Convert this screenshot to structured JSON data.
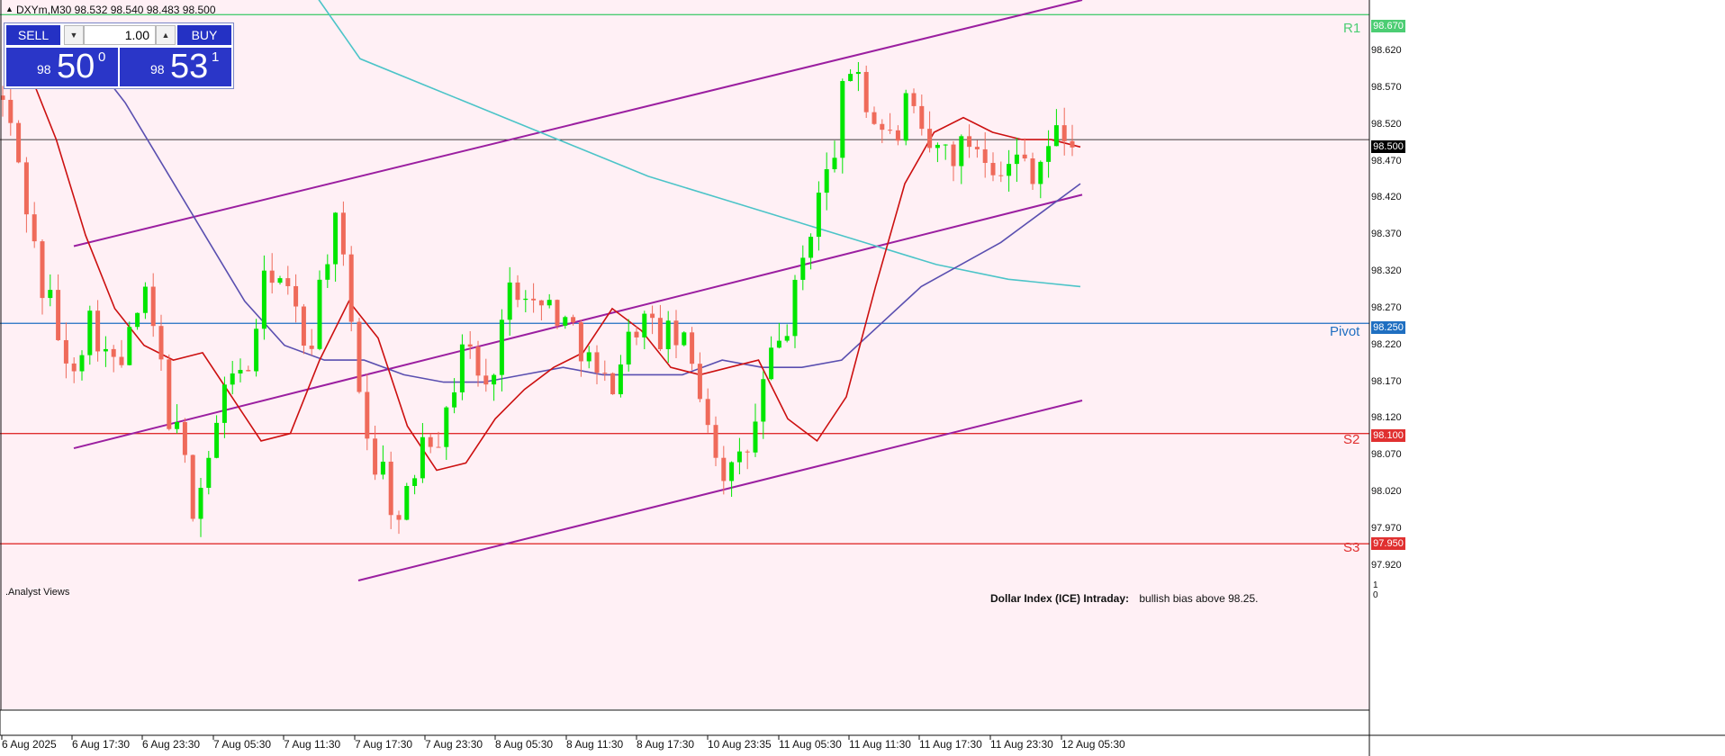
{
  "symbol_info": "DXYm,M30  98.532 98.540 98.483 98.500",
  "trade_panel": {
    "sell_label": "SELL",
    "buy_label": "BUY",
    "volume": "1.00",
    "sell_price": {
      "prefix": "98",
      "big": "50",
      "sup": "0"
    },
    "buy_price": {
      "prefix": "98",
      "big": "53",
      "sup": "1"
    }
  },
  "levels": {
    "r1": {
      "label": "R1",
      "value": "98.670",
      "color": "#4ccd73"
    },
    "pivot": {
      "label": "Pivot",
      "value": "98.250",
      "color": "#1f6fc1"
    },
    "s2": {
      "label": "S2",
      "value": "98.100",
      "color": "#e03030"
    },
    "s3": {
      "label": "S3",
      "value": "97.950",
      "color": "#e03030"
    },
    "current": {
      "value": "98.500",
      "color": "#000000"
    }
  },
  "y_axis_ticks": [
    "98.620",
    "98.570",
    "98.520",
    "98.470",
    "98.420",
    "98.370",
    "98.320",
    "98.270",
    "98.220",
    "98.170",
    "98.120",
    "98.070",
    "98.020",
    "97.970",
    "97.920"
  ],
  "x_axis_ticks": [
    "6 Aug 2025",
    "6 Aug 17:30",
    "6 Aug 23:30",
    "7 Aug 05:30",
    "7 Aug 11:30",
    "7 Aug 17:30",
    "7 Aug 23:30",
    "8 Aug 05:30",
    "8 Aug 11:30",
    "8 Aug 17:30",
    "10 Aug 23:35",
    "11 Aug 05:30",
    "11 Aug 11:30",
    "11 Aug 17:30",
    "11 Aug 23:30",
    "12 Aug 05:30"
  ],
  "subwindow": {
    "label": ".Analyst Views",
    "scale_top": "1",
    "scale_bottom": "0"
  },
  "caption": {
    "title": "Dollar Index (ICE) Intraday:",
    "text": "bullish bias above 98.25."
  },
  "chart_data": {
    "type": "candlestick",
    "title": "DXYm,M30",
    "timeframe": "M30",
    "ylim": [
      97.9,
      98.69
    ],
    "y_label_values": [
      98.62,
      98.57,
      98.52,
      98.47,
      98.42,
      98.37,
      98.32,
      98.27,
      98.22,
      98.17,
      98.12,
      98.07,
      98.02,
      97.97,
      97.92
    ],
    "colors": {
      "up": "#00e600",
      "down": "#ef6a5a",
      "channel": "#9b1fa0",
      "ma_fast": "#cc1010",
      "ma_mid": "#5a4fb0",
      "ma_slow": "#4cc4c8",
      "background": "#fff0f5"
    },
    "key_points": {
      "low": 97.93,
      "high": 98.65,
      "close": 98.5
    },
    "channel_lines": [
      {
        "name": "upper",
        "from": [
          0,
          98.355
        ],
        "to": [
          136,
          98.69
        ]
      },
      {
        "name": "middle",
        "from": [
          0,
          98.08
        ],
        "to": [
          136,
          98.425
        ]
      },
      {
        "name": "lower",
        "from": [
          36,
          97.9
        ],
        "to": [
          136,
          98.145
        ]
      }
    ],
    "close_path": [
      98.55,
      98.49,
      98.4,
      98.3,
      98.27,
      98.18,
      98.22,
      98.26,
      98.21,
      98.18,
      98.23,
      98.29,
      98.23,
      98.13,
      98.08,
      98.0,
      98.06,
      98.12,
      98.2,
      98.16,
      98.26,
      98.33,
      98.3,
      98.26,
      98.21,
      98.31,
      98.39,
      98.3,
      98.17,
      98.06,
      98.05,
      97.97,
      98.02,
      98.11,
      98.1,
      98.12,
      98.23,
      98.2,
      98.15,
      98.24,
      98.3,
      98.31,
      98.26,
      98.28,
      98.25,
      98.24,
      98.2,
      98.16,
      98.18,
      98.22,
      98.26,
      98.24,
      98.23,
      98.23,
      98.2,
      98.15,
      98.08,
      98.04,
      98.06,
      98.1,
      98.19,
      98.22,
      98.27,
      98.35,
      98.42,
      98.46,
      98.56,
      98.62,
      98.53,
      98.52,
      98.49,
      98.55,
      98.5,
      98.48,
      98.49,
      98.48,
      98.5,
      98.49,
      98.47,
      98.46,
      98.48,
      98.46,
      98.49,
      98.51,
      98.5
    ],
    "ma_fast": [
      98.6,
      98.5,
      98.37,
      98.27,
      98.22,
      98.2,
      98.21,
      98.15,
      98.09,
      98.1,
      98.2,
      98.28,
      98.23,
      98.11,
      98.05,
      98.06,
      98.12,
      98.16,
      98.19,
      98.21,
      98.27,
      98.24,
      98.19,
      98.18,
      98.19,
      98.2,
      98.12,
      98.09,
      98.15,
      98.3,
      98.44,
      98.51,
      98.53,
      98.51,
      98.5,
      98.5,
      98.49
    ],
    "ma_mid": [
      98.62,
      98.55,
      98.46,
      98.37,
      98.28,
      98.22,
      98.2,
      98.2,
      98.18,
      98.17,
      98.17,
      98.18,
      98.19,
      98.18,
      98.18,
      98.18,
      98.2,
      98.19,
      98.19,
      98.2,
      98.25,
      98.3,
      98.33,
      98.36,
      98.4,
      98.44
    ],
    "ma_slow": [
      98.75,
      98.61,
      98.57,
      98.53,
      98.49,
      98.45,
      98.42,
      98.39,
      98.36,
      98.33,
      98.31,
      98.3
    ]
  }
}
